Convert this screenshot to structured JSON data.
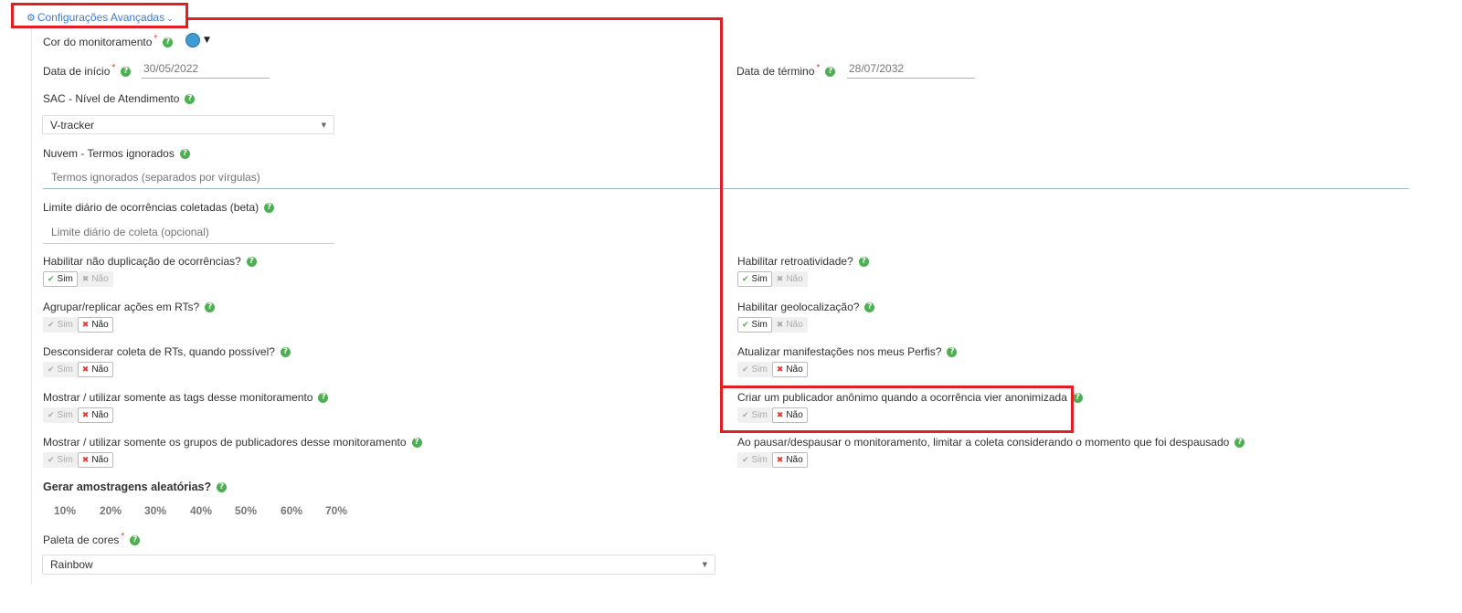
{
  "header": {
    "title": "Configurações Avançadas",
    "icon": "gear-icon",
    "accent": "#3a7bd5"
  },
  "monitor_color": {
    "label": "Cor do monitoramento",
    "required": "*",
    "value": "#3f9bd6"
  },
  "start_date": {
    "label": "Data de início",
    "required": "*",
    "value": "30/05/2022"
  },
  "end_date": {
    "label": "Data de término",
    "required": "*",
    "value": "28/07/2032"
  },
  "sac": {
    "label": "SAC - Nível de Atendimento",
    "value": "V-tracker"
  },
  "cloud": {
    "label": "Nuvem - Termos ignorados",
    "placeholder": "Termos ignorados (separados por vírgulas)"
  },
  "daily_limit": {
    "label": "Limite diário de ocorrências coletadas (beta)",
    "placeholder": "Limite diário de coleta (opcional)"
  },
  "toggles": {
    "yes_label": "Sim",
    "no_label": "Não",
    "left": [
      {
        "label": "Habilitar não duplicação de ocorrências?",
        "value": "Sim"
      },
      {
        "label": "Agrupar/replicar ações em RTs?",
        "value": "Não"
      },
      {
        "label": "Desconsiderar coleta de RTs, quando possível?",
        "value": "Não"
      },
      {
        "label": "Mostrar / utilizar somente as tags desse monitoramento",
        "value": "Não"
      },
      {
        "label": "Mostrar / utilizar somente os grupos de publicadores desse monitoramento",
        "value": "Não"
      }
    ],
    "right": [
      {
        "label": "Habilitar retroatividade?",
        "value": "Sim"
      },
      {
        "label": "Habilitar geolocalização?",
        "value": "Sim"
      },
      {
        "label": "Atualizar manifestações nos meus Perfis?",
        "value": "Não"
      },
      {
        "label": "Criar um publicador anônimo quando a ocorrência vier anonimizada",
        "value": "Não"
      },
      {
        "label": "Ao pausar/despausar o monitoramento, limitar a coleta considerando o momento que foi despausado",
        "value": "Não"
      }
    ]
  },
  "sampling": {
    "label": "Gerar amostragens aleatórias?",
    "options": [
      "10%",
      "20%",
      "30%",
      "40%",
      "50%",
      "60%",
      "70%"
    ]
  },
  "palette": {
    "label": "Paleta de cores",
    "required": "*",
    "value": "Rainbow"
  },
  "colors": {
    "highlight": "#e21d24",
    "help": "#4caf50",
    "on_yes": "#4caf50",
    "on_no": "#e53935"
  }
}
